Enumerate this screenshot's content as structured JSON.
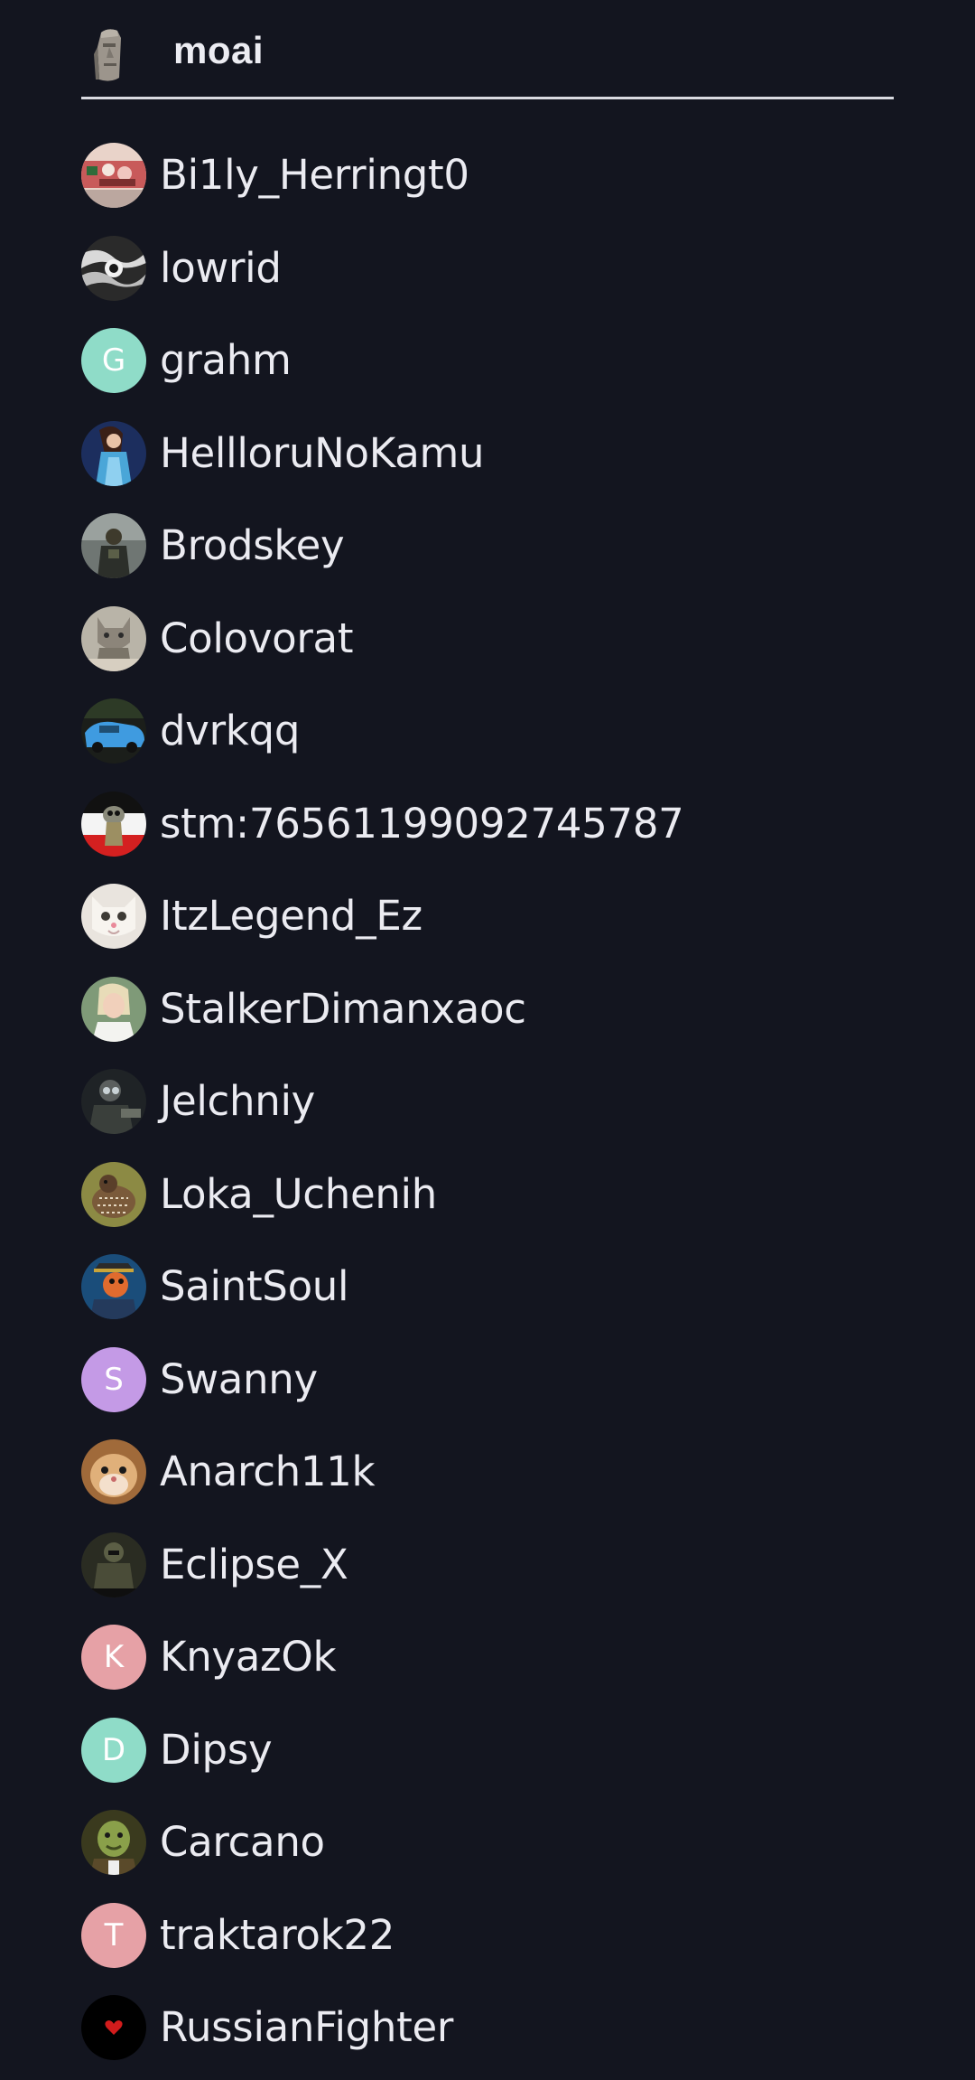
{
  "header": {
    "title": "moai",
    "avatar_icon": "moai-avatar"
  },
  "members": [
    {
      "name": "Bi1ly_Herringt0",
      "avatar": "photo"
    },
    {
      "name": "lowrid",
      "avatar": "photo"
    },
    {
      "name": "grahm",
      "avatar": "letter",
      "letter": "G",
      "color": "#8fdcc8"
    },
    {
      "name": "HellloruNoKamu",
      "avatar": "photo"
    },
    {
      "name": "Brodskey",
      "avatar": "photo"
    },
    {
      "name": "Colovorat",
      "avatar": "photo"
    },
    {
      "name": "dvrkqq",
      "avatar": "photo"
    },
    {
      "name": "stm:76561199092745787",
      "avatar": "photo"
    },
    {
      "name": "ItzLegend_Ez",
      "avatar": "photo"
    },
    {
      "name": "StalkerDimanxaoc",
      "avatar": "photo"
    },
    {
      "name": "Jelchniy",
      "avatar": "photo"
    },
    {
      "name": "Loka_Uchenih",
      "avatar": "photo"
    },
    {
      "name": "SaintSoul",
      "avatar": "photo"
    },
    {
      "name": "Swanny",
      "avatar": "letter",
      "letter": "S",
      "color": "#c49ae6"
    },
    {
      "name": "Anarch11k",
      "avatar": "photo"
    },
    {
      "name": "Eclipse_X",
      "avatar": "photo"
    },
    {
      "name": "KnyazOk",
      "avatar": "letter",
      "letter": "K",
      "color": "#e6a1a6"
    },
    {
      "name": "Dipsy",
      "avatar": "letter",
      "letter": "D",
      "color": "#8fdcc8"
    },
    {
      "name": "Carcano",
      "avatar": "photo"
    },
    {
      "name": "traktarok22",
      "avatar": "letter",
      "letter": "T",
      "color": "#e6a1a6"
    },
    {
      "name": "RussianFighter",
      "avatar": "photo"
    }
  ]
}
